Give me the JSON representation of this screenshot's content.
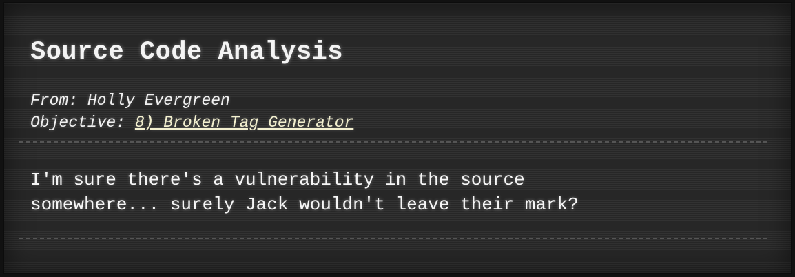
{
  "hint": {
    "title": "Source Code Analysis",
    "from_label": "From:",
    "from_name": "Holly Evergreen",
    "objective_label": "Objective:",
    "objective_link": "8) Broken Tag Generator",
    "message_lines": [
      "I'm sure there's a vulnerability in the source",
      "somewhere... surely Jack wouldn't leave their mark?"
    ]
  },
  "colors": {
    "background": "#2a2a2a",
    "text": "#f4f4f4",
    "link": "#f3f0cf",
    "divider": "#555555"
  }
}
